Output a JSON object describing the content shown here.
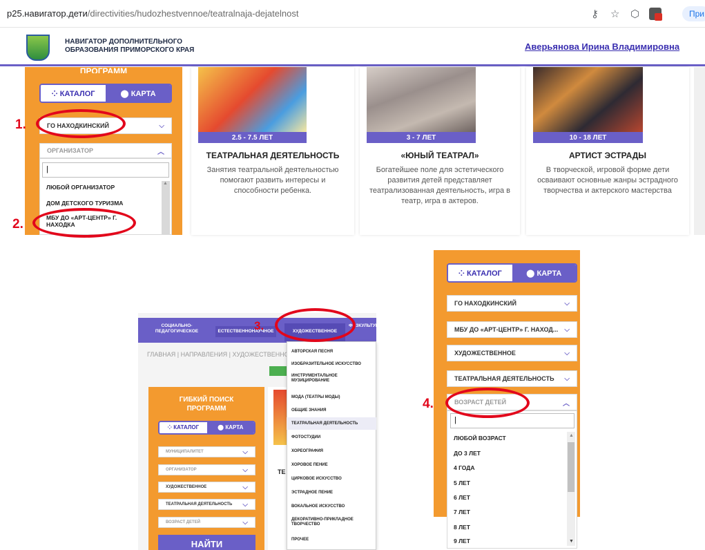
{
  "browser": {
    "url_host": "p25.навигатор.дети",
    "url_path": "/directivities/hudozhestvennoe/teatralnaja-dejatelnost",
    "tab_label": "При"
  },
  "site": {
    "title_line1": "НАВИГАТОР ДОПОЛНИТЕЛЬНОГО",
    "title_line2": "ОБРАЗОВАНИЯ ПРИМОРСКОГО КРАЯ",
    "user_name": "Аверьянова Ирина Владимировна"
  },
  "panel1": {
    "sidebar_title": "ПРОГРАММ",
    "tab_catalog": "КАТАЛОГ",
    "tab_map": "КАРТА",
    "municipality": "ГО НАХОДКИНСКИЙ",
    "organizer_label": "ОРГАНИЗАТОР",
    "search_value": "|",
    "organizer_options": [
      "ЛЮБОЙ ОРГАНИЗАТОР",
      "ДОМ ДЕТСКОГО ТУРИЗМА",
      "МБУ ДО «АРТ-ЦЕНТР» Г. НАХОДКА"
    ],
    "cards": [
      {
        "age": "2.5 - 7.5 ЛЕТ",
        "title": "ТЕАТРАЛЬНАЯ ДЕЯТЕЛЬНОСТЬ",
        "desc": "Занятия театральной деятельностью помогают развить интересы и способности ребенка."
      },
      {
        "age": "3 - 7 ЛЕТ",
        "title": "«ЮНЫЙ ТЕАТРАЛ»",
        "desc": "Богатейшее поле для эстетического развития детей представляет театрализованная деятельность, игра в театр, игра в актеров."
      },
      {
        "age": "10 - 18 ЛЕТ",
        "title": "АРТИСТ ЭСТРАДЫ",
        "desc": "В творческой, игровой форме дети осваивают основные жанры эстрадного творчества и актерского мастерства"
      }
    ]
  },
  "panel3": {
    "nav": [
      "СОЦИАЛЬНО-ПЕДАГОГИЧЕСКОЕ",
      "ЕСТЕСТВЕННОНАУЧНОЕ",
      "ХУДОЖЕСТВЕННОЕ",
      "ФИЗКУЛЬТУРНО-СПОРТИВНОЕ"
    ],
    "breadcrumb": "ГЛАВНАЯ | НАПРАВЛЕНИЯ | ХУДОЖЕСТВЕННОЕ | ТЕАТРАЛЬНАЯ ДЕЯТЕЛЬНОСТЬ",
    "sidebar_title_1": "ГИБКИЙ ПОИСК",
    "sidebar_title_2": "ПРОГРАММ",
    "tab_catalog": "КАТАЛОГ",
    "tab_map": "КАРТА",
    "filters": [
      "МУНИЦИПАЛИТЕТ",
      "ОРГАНИЗАТОР",
      "ХУДОЖЕСТВЕННОЕ",
      "ТЕАТРАЛЬНАЯ ДЕЯТЕЛЬНОСТЬ",
      "ВОЗРАСТ ДЕТЕЙ"
    ],
    "find_button": "НАЙТИ",
    "menu_items": [
      "АВТОРСКАЯ ПЕСНЯ",
      "ИЗОБРАЗИТЕЛЬНОЕ ИСКУССТВО",
      "ИНСТРУМЕНТАЛЬНОЕ МУЗИЦИРОВАНИЕ",
      "МОДА (ТЕАТРЫ МОДЫ)",
      "ОБЩИЕ ЗНАНИЯ",
      "ТЕАТРАЛЬНАЯ ДЕЯТЕЛЬНОСТЬ",
      "ФОТОСТУДИИ",
      "ХОРЕОГРАФИЯ",
      "ХОРОВОЕ ПЕНИЕ",
      "ЦИРКОВОЕ ИСКУССТВО",
      "ЭСТРАДНОЕ ПЕНИЕ",
      "ВОКАЛЬНОЕ ИСКУССТВО",
      "ДЕКОРАТИВНО-ПРИКЛАДНОЕ ТВОРЧЕСТВО",
      "ПРОЧЕЕ"
    ],
    "peek_text": "ТЕ"
  },
  "panel4": {
    "tab_catalog": "КАТАЛОГ",
    "tab_map": "КАРТА",
    "filters": [
      "ГО НАХОДКИНСКИЙ",
      "МБУ ДО «АРТ-ЦЕНТР» Г. НАХОД...",
      "ХУДОЖЕСТВЕННОЕ",
      "ТЕАТРАЛЬНАЯ ДЕЯТЕЛЬНОСТЬ"
    ],
    "age_label": "ВОЗРАСТ ДЕТЕЙ",
    "search_value": "|",
    "age_options": [
      "ЛЮБОЙ ВОЗРАСТ",
      "ДО 3 ЛЕТ",
      "4 ГОДА",
      "5 ЛЕТ",
      "6 ЛЕТ",
      "7 ЛЕТ",
      "8 ЛЕТ",
      "9 ЛЕТ"
    ]
  },
  "markers": [
    "1.",
    "2.",
    "3.",
    "4."
  ]
}
